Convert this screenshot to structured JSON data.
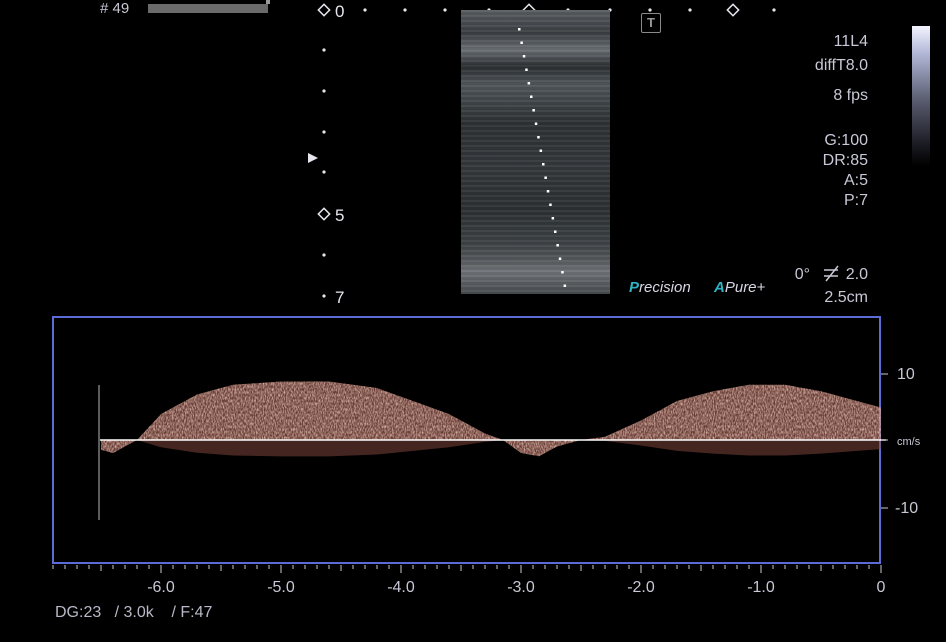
{
  "header": {
    "frame_number": "# 49",
    "probe": "11L4",
    "preset": "diffT8.0",
    "frame_rate": "8 fps",
    "gain": "G:100",
    "dynamic_range": "DR:85",
    "a_param": "A:5",
    "p_param": "P:7",
    "angle": "0°",
    "angle_value": "2.0",
    "depth": "2.5cm",
    "t_icon_label": "T"
  },
  "depth_scale": {
    "labels": [
      "0",
      "5",
      "7"
    ]
  },
  "branding": {
    "precision_first": "P",
    "precision_rest": "recision",
    "apure_first": "A",
    "apure_rest": "Pure",
    "apure_plus": "+"
  },
  "spectral": {
    "y_ticks": [
      "10",
      "-10"
    ],
    "y_unit": "cm/s",
    "x_ticks": [
      "-6.0",
      "-5.0",
      "-4.0",
      "-3.0",
      "-2.0",
      "-1.0",
      "0"
    ]
  },
  "footer": {
    "text": "DG:23   / 3.0k    / F:47"
  },
  "colors": {
    "doppler": "#e8a090",
    "frame_border": "#5d6bd6",
    "brand_accent": "#2fb4c6"
  },
  "chart_data": {
    "type": "area",
    "title": "",
    "xlabel": "",
    "ylabel": "cm/s",
    "x": [
      -6.5,
      -6.4,
      -6.3,
      -6.2,
      -6.0,
      -5.7,
      -5.4,
      -5.0,
      -4.6,
      -4.2,
      -3.9,
      -3.6,
      -3.3,
      -3.15,
      -3.0,
      -2.85,
      -2.7,
      -2.5,
      -2.3,
      -2.0,
      -1.7,
      -1.4,
      -1.1,
      -0.8,
      -0.5,
      -0.2,
      0
    ],
    "series": [
      {
        "values": [
          -1.5,
          -2,
          -1,
          0,
          4,
          7,
          8.5,
          9,
          9,
          8,
          6,
          4,
          1,
          0,
          -2,
          -2.5,
          -1,
          0,
          0.5,
          3,
          6,
          7.5,
          8.5,
          8.5,
          7.5,
          6,
          5
        ]
      }
    ],
    "xlim": [
      -6.9,
      0
    ],
    "ylim": [
      -17,
      17
    ],
    "y_ticks": [
      10,
      -10
    ],
    "x_ticks": [
      -6,
      -5,
      -4,
      -3,
      -2,
      -1,
      0
    ],
    "grid": false
  }
}
